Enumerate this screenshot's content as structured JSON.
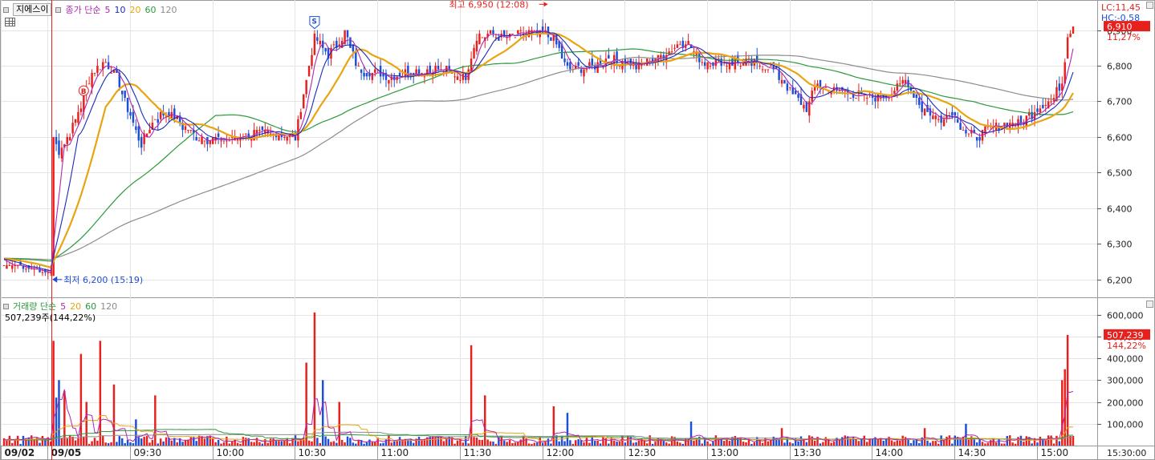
{
  "colors": {
    "up": "#e8201d",
    "down": "#1d4fd6",
    "ma5": "#b028b0",
    "ma10": "#1a2bb8",
    "ma20": "#e8a511",
    "ma60": "#2c9a3c",
    "ma120": "#8c8c8c",
    "axis_label_bg": "#e8201d"
  },
  "price_legend": {
    "stock_name": "지에스이",
    "label": "종가 단순",
    "periods": [
      "5",
      "10",
      "20",
      "60",
      "120"
    ]
  },
  "volume_legend": {
    "label": "거래량 단순",
    "periods": [
      "5",
      "20",
      "60",
      "120"
    ],
    "current_text": "507,239주(144,22%)"
  },
  "right_axis": {
    "lc": "LC:11,45",
    "hc": "HC:-0,58",
    "current_price": "6,910",
    "current_pct": "11,27%",
    "current_volume": "507,239",
    "current_volume_pct": "144,22%",
    "last_time": "15:30:00"
  },
  "annotations": {
    "high": "최고 6,950 (12:08)",
    "low": "최저 6,200 (15:19)",
    "marker_b": "B",
    "marker_s": "S"
  },
  "chart_data": [
    {
      "type": "candlestick",
      "title": "",
      "ylim": [
        6150,
        6980
      ],
      "y_ticks": [
        "6,900",
        "6,800",
        "6,700",
        "6,600",
        "6,500",
        "6,400",
        "6,300",
        "6,200"
      ],
      "y_tick_values": [
        6900,
        6800,
        6700,
        6600,
        6500,
        6400,
        6300,
        6200
      ],
      "x_ticks": [
        "09/02",
        "09/05",
        "09:30",
        "10:00",
        "10:30",
        "11:00",
        "11:30",
        "12:00",
        "12:30",
        "13:00",
        "13:30",
        "14:00",
        "14:30",
        "15:00"
      ],
      "grid": true,
      "close_anchor_points": [
        [
          0,
          6240
        ],
        [
          6,
          6235
        ],
        [
          12,
          6225
        ],
        [
          17,
          6215
        ],
        [
          18,
          6600
        ],
        [
          20,
          6560
        ],
        [
          24,
          6610
        ],
        [
          28,
          6690
        ],
        [
          32,
          6780
        ],
        [
          37,
          6810
        ],
        [
          41,
          6770
        ],
        [
          45,
          6680
        ],
        [
          50,
          6580
        ],
        [
          55,
          6650
        ],
        [
          60,
          6670
        ],
        [
          65,
          6630
        ],
        [
          70,
          6600
        ],
        [
          80,
          6590
        ],
        [
          90,
          6610
        ],
        [
          100,
          6610
        ],
        [
          106,
          6600
        ],
        [
          110,
          6760
        ],
        [
          113,
          6880
        ],
        [
          118,
          6830
        ],
        [
          124,
          6890
        ],
        [
          129,
          6790
        ],
        [
          135,
          6780
        ],
        [
          140,
          6770
        ],
        [
          148,
          6780
        ],
        [
          158,
          6790
        ],
        [
          168,
          6770
        ],
        [
          172,
          6880
        ],
        [
          176,
          6890
        ],
        [
          182,
          6880
        ],
        [
          190,
          6890
        ],
        [
          196,
          6890
        ],
        [
          200,
          6880
        ],
        [
          205,
          6790
        ],
        [
          212,
          6790
        ],
        [
          220,
          6820
        ],
        [
          230,
          6800
        ],
        [
          240,
          6830
        ],
        [
          248,
          6870
        ],
        [
          254,
          6810
        ],
        [
          260,
          6810
        ],
        [
          270,
          6810
        ],
        [
          278,
          6800
        ],
        [
          283,
          6760
        ],
        [
          288,
          6710
        ],
        [
          292,
          6680
        ],
        [
          296,
          6750
        ],
        [
          302,
          6730
        ],
        [
          308,
          6720
        ],
        [
          315,
          6710
        ],
        [
          322,
          6720
        ],
        [
          328,
          6760
        ],
        [
          334,
          6680
        ],
        [
          340,
          6650
        ],
        [
          345,
          6670
        ],
        [
          350,
          6610
        ],
        [
          354,
          6600
        ],
        [
          358,
          6620
        ],
        [
          364,
          6640
        ],
        [
          370,
          6640
        ],
        [
          376,
          6680
        ],
        [
          381,
          6700
        ],
        [
          385,
          6750
        ],
        [
          387,
          6890
        ],
        [
          389,
          6910
        ]
      ],
      "bar_count": 390,
      "session_break_index": 17
    },
    {
      "type": "bar",
      "title": "",
      "ylim": [
        0,
        650000
      ],
      "y_ticks": [
        "600,000",
        "500,000",
        "400,000",
        "300,000",
        "200,000",
        "100,000"
      ],
      "y_tick_values": [
        600000,
        500000,
        400000,
        300000,
        200000,
        100000
      ],
      "spikes": [
        [
          18,
          480000
        ],
        [
          19,
          220000
        ],
        [
          20,
          300000
        ],
        [
          22,
          250000
        ],
        [
          28,
          420000
        ],
        [
          30,
          200000
        ],
        [
          35,
          480000
        ],
        [
          40,
          280000
        ],
        [
          48,
          120000
        ],
        [
          55,
          230000
        ],
        [
          110,
          380000
        ],
        [
          113,
          610000
        ],
        [
          116,
          300000
        ],
        [
          122,
          200000
        ],
        [
          170,
          460000
        ],
        [
          175,
          230000
        ],
        [
          200,
          180000
        ],
        [
          205,
          150000
        ],
        [
          250,
          110000
        ],
        [
          283,
          80000
        ],
        [
          335,
          80000
        ],
        [
          350,
          100000
        ],
        [
          385,
          300000
        ],
        [
          386,
          350000
        ],
        [
          387,
          507239
        ]
      ],
      "baseline_volume": 25000
    }
  ]
}
